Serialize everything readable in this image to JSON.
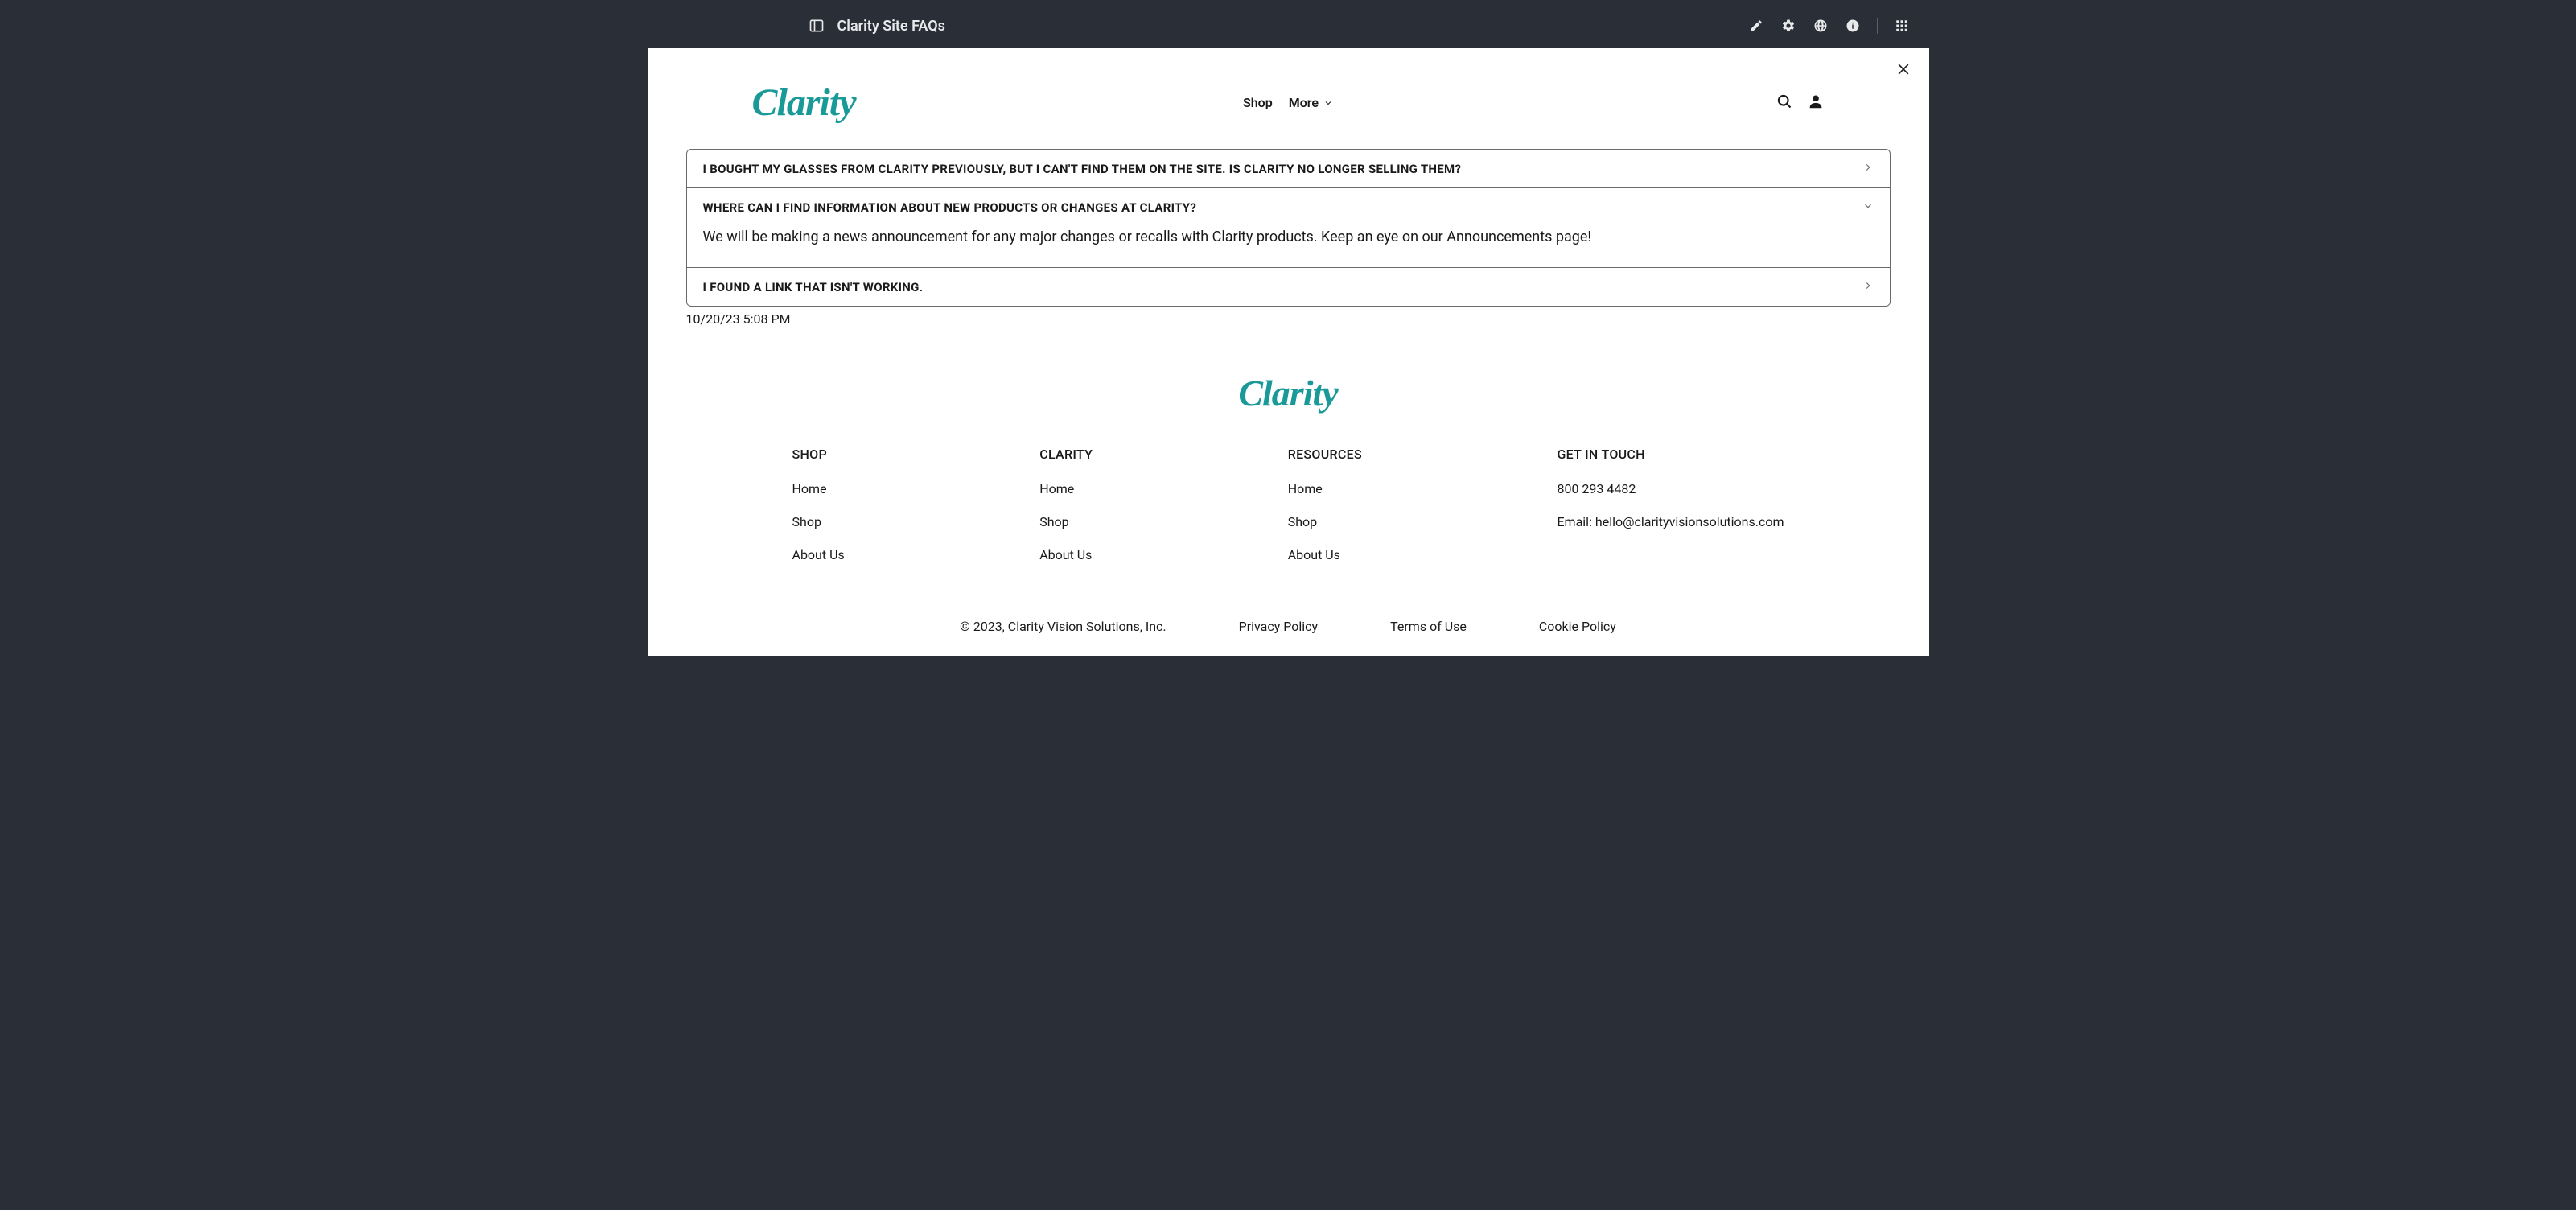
{
  "topbar": {
    "title": "Clarity Site FAQs"
  },
  "site": {
    "brand": "Clarity",
    "nav": {
      "shop": "Shop",
      "more": "More"
    }
  },
  "faq": {
    "items": [
      {
        "question": "I BOUGHT MY GLASSES FROM CLARITY PREVIOUSLY, BUT I CAN'T FIND THEM ON THE SITE. IS CLARITY NO LONGER SELLING THEM?",
        "expanded": false
      },
      {
        "question": "WHERE CAN I FIND INFORMATION ABOUT NEW PRODUCTS OR CHANGES AT CLARITY?",
        "answer": "We will be making a news announcement for any major changes or recalls with Clarity products. Keep an eye on our Announcements page!",
        "expanded": true
      },
      {
        "question": "I FOUND A LINK THAT ISN'T WORKING.",
        "expanded": false
      }
    ]
  },
  "timestamp": "10/20/23 5:08 PM",
  "footer": {
    "columns": [
      {
        "heading": "SHOP",
        "links": [
          "Home",
          "Shop",
          "About Us"
        ]
      },
      {
        "heading": "CLARITY",
        "links": [
          "Home",
          "Shop",
          "About Us"
        ]
      },
      {
        "heading": "RESOURCES",
        "links": [
          "Home",
          "Shop",
          "About Us"
        ]
      }
    ],
    "contact": {
      "heading": "GET IN TOUCH",
      "phone": "800 293 4482",
      "email": "Email: hello@clarityvisionsolutions.com"
    },
    "bottom": {
      "copyright": "© 2023, Clarity Vision Solutions, Inc.",
      "links": [
        "Privacy Policy",
        "Terms of Use",
        "Cookie Policy"
      ]
    }
  }
}
